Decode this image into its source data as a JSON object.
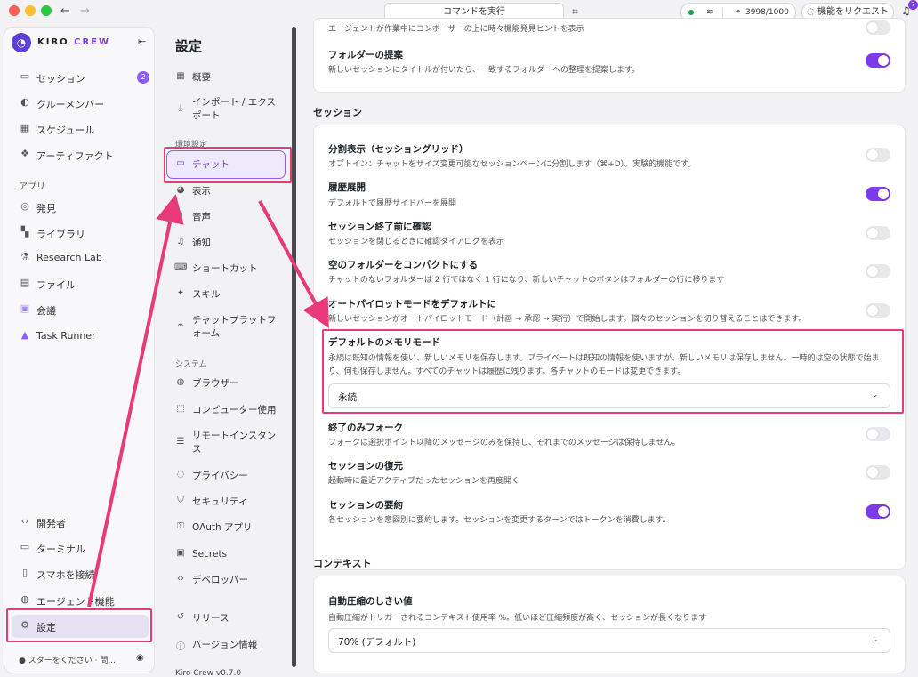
{
  "titlebar": {
    "command_label": "コマンドを実行",
    "tokens": "3998/1000",
    "feature_request": "機能をリクエスト",
    "notification_count": "7"
  },
  "sidebar": {
    "brand_main": "KIRO",
    "brand_accent": "CREW",
    "top_items": [
      {
        "label": "セッション",
        "icon": "chat-bubble-icon",
        "badge": "2"
      },
      {
        "label": "クルーメンバー",
        "icon": "users-icon"
      },
      {
        "label": "スケジュール",
        "icon": "calendar-icon"
      },
      {
        "label": "アーティファクト",
        "icon": "artifact-icon"
      }
    ],
    "apps_label": "アプリ",
    "app_items": [
      {
        "label": "発見",
        "icon": "compass-icon"
      },
      {
        "label": "ライブラリ",
        "icon": "grid-icon"
      },
      {
        "label": "Research Lab",
        "icon": "flask-icon"
      },
      {
        "label": "ファイル",
        "icon": "file-icon"
      },
      {
        "label": "会議",
        "icon": "meeting-icon"
      },
      {
        "label": "Task Runner",
        "icon": "rocket-icon"
      }
    ],
    "bottom_items": [
      {
        "label": "開発者",
        "icon": "code-icon"
      },
      {
        "label": "ターミナル",
        "icon": "terminal-icon"
      },
      {
        "label": "スマホを接続",
        "icon": "phone-icon"
      },
      {
        "label": "エージェント機能",
        "icon": "agent-icon"
      },
      {
        "label": "設定",
        "icon": "gear-icon"
      }
    ],
    "footer": "スターをください · 問..."
  },
  "settings_nav": {
    "title": "設定",
    "items_top": [
      {
        "label": "概要",
        "icon": "layout-icon"
      },
      {
        "label": "インポート / エクスポート",
        "icon": "import-icon"
      }
    ],
    "section_env": "環境設定",
    "items_env": [
      {
        "label": "チャット",
        "icon": "chat-bubble-icon"
      },
      {
        "label": "表示",
        "icon": "palette-icon"
      },
      {
        "label": "音声",
        "icon": "speaker-icon"
      },
      {
        "label": "通知",
        "icon": "bell-icon"
      },
      {
        "label": "ショートカット",
        "icon": "keyboard-icon"
      },
      {
        "label": "スキル",
        "icon": "sparkle-icon"
      },
      {
        "label": "チャットプラットフォーム",
        "icon": "link-icon"
      }
    ],
    "section_system": "システム",
    "items_system": [
      {
        "label": "ブラウザー",
        "icon": "globe-icon"
      },
      {
        "label": "コンピューター使用",
        "icon": "cursor-icon"
      },
      {
        "label": "リモートインスタンス",
        "icon": "server-icon"
      },
      {
        "label": "プライバシー",
        "icon": "fingerprint-icon"
      },
      {
        "label": "セキュリティ",
        "icon": "shield-icon"
      },
      {
        "label": "OAuth アプリ",
        "icon": "key-icon"
      },
      {
        "label": "Secrets",
        "icon": "lock-icon"
      },
      {
        "label": "デベロッパー",
        "icon": "code-icon"
      }
    ],
    "items_bottom": [
      {
        "label": "リリース",
        "icon": "history-icon"
      },
      {
        "label": "バージョン情報",
        "icon": "info-icon"
      }
    ],
    "version": "Kiro Crew v0.7.0"
  },
  "main": {
    "top_card": {
      "partial_desc": "エージェントが作業中にコンポーザーの上に時々機能発見ヒントを表示",
      "folder_title": "フォルダーの提案",
      "folder_desc": "新しいセッションにタイトルが付いたら、一致するフォルダーへの整理を提案します。"
    },
    "session_title": "セッション",
    "session_rows": [
      {
        "title": "分割表示（セッショングリッド）",
        "desc": "オプトイン：チャットをサイズ変更可能なセッションペーンに分割します（⌘+D）。実験的機能です。"
      },
      {
        "title": "履歴展開",
        "desc": "デフォルトで履歴サイドバーを展開"
      },
      {
        "title": "セッション終了前に確認",
        "desc": "セッションを閉じるときに確認ダイアログを表示"
      },
      {
        "title": "空のフォルダーをコンパクトにする",
        "desc": "チャットのないフォルダーは 2 行ではなく 1 行になり、新しいチャットのボタンはフォルダーの行に移ります"
      },
      {
        "title": "オートパイロットモードをデフォルトに",
        "desc": "新しいセッションがオートパイロットモード（計画 → 承認 → 実行）で開始します。個々のセッションを切り替えることはできます。"
      }
    ],
    "memory": {
      "title": "デフォルトのメモリモード",
      "desc": "永続は既知の情報を使い、新しいメモリを保存します。プライベートは既知の情報を使いますが、新しいメモリは保存しません。一時的は空の状態で始まり、何も保存しません。すべてのチャットは履歴に残ります。各チャットのモードは変更できます。",
      "value": "永続"
    },
    "session_rows_after": [
      {
        "title": "終了のみフォーク",
        "desc": "フォークは選択ポイント以降のメッセージのみを保持し、それまでのメッセージは保持しません。"
      },
      {
        "title": "セッションの復元",
        "desc": "起動時に最近アクティブだったセッションを再度開く"
      },
      {
        "title": "セッションの要約",
        "desc": "各セッションを意図別に要約します。セッションを変更するターンではトークンを消費します。"
      }
    ],
    "context_title": "コンテキスト",
    "context": {
      "title": "自動圧縮のしきい値",
      "desc": "自動圧縮がトリガーされるコンテキスト使用率 %。低いほど圧縮頻度が高く、セッションが長くなります",
      "value": "70% (デフォルト)"
    }
  },
  "colors": {
    "accent": "#7c3aed",
    "highlight": "#e83a7a"
  }
}
